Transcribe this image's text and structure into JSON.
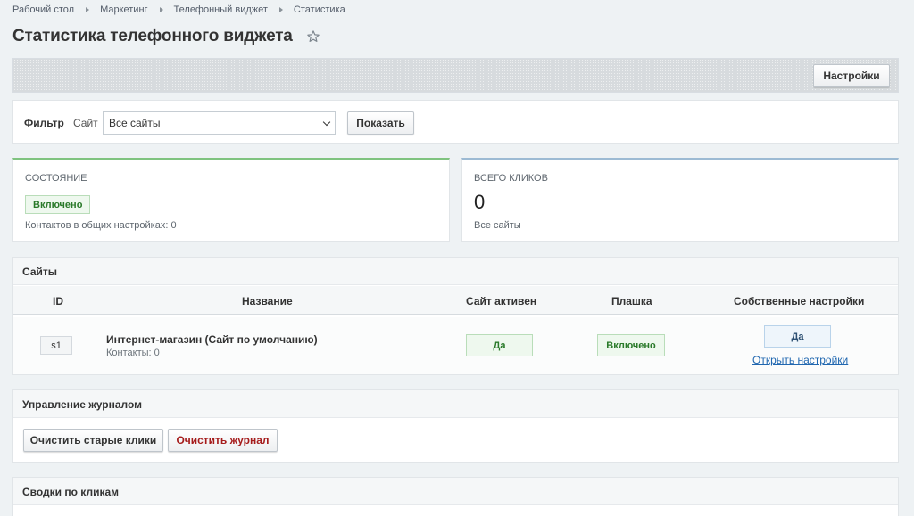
{
  "breadcrumbs": [
    "Рабочий стол",
    "Маркетинг",
    "Телефонный виджет",
    "Статистика"
  ],
  "page_title": "Статистика телефонного виджета",
  "toolbar": {
    "settings_label": "Настройки"
  },
  "filter": {
    "label": "Фильтр",
    "site_label": "Сайт",
    "site_value": "Все сайты",
    "show_label": "Показать"
  },
  "status_card": {
    "title": "СОСТОЯНИЕ",
    "badge": "Включено",
    "subtitle": "Контактов в общих настройках: 0"
  },
  "clicks_card": {
    "title": "ВСЕГО КЛИКОВ",
    "value": "0",
    "subtitle": "Все сайты"
  },
  "sites": {
    "title": "Сайты",
    "columns": [
      "ID",
      "Название",
      "Сайт активен",
      "Плашка",
      "Собственные настройки"
    ],
    "rows": [
      {
        "id": "s1",
        "name": "Интернет-магазин (Сайт по умолчанию)",
        "contacts": "Контакты: 0",
        "active": "Да",
        "badge": "Включено",
        "own_settings": "Да",
        "open_settings": "Открыть настройки"
      }
    ]
  },
  "journal": {
    "title": "Управление журналом",
    "clear_old_label": "Очистить старые клики",
    "clear_log_label": "Очистить журнал"
  },
  "summary": {
    "title": "Сводки по кликам"
  },
  "colors": {
    "background": "#eef2f4",
    "success": "#2a7a2a",
    "danger": "#a51b1b",
    "link": "#2067b0"
  }
}
